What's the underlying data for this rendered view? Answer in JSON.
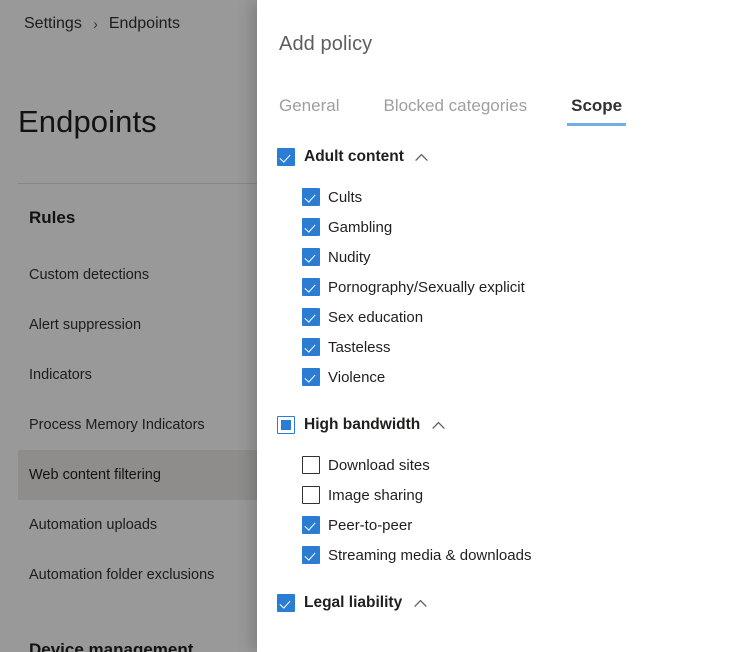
{
  "background": {
    "breadcrumb": {
      "items": [
        "Settings",
        "Endpoints"
      ],
      "separator": "›"
    },
    "page_title": "Endpoints",
    "nav_heading": "Rules",
    "nav_items": [
      {
        "label": "Custom detections",
        "selected": false
      },
      {
        "label": "Alert suppression",
        "selected": false
      },
      {
        "label": "Indicators",
        "selected": false
      },
      {
        "label": "Process Memory Indicators",
        "selected": false
      },
      {
        "label": "Web content filtering",
        "selected": true
      },
      {
        "label": "Automation uploads",
        "selected": false
      },
      {
        "label": "Automation folder exclusions",
        "selected": false
      }
    ],
    "nav_footer_heading": "Device management"
  },
  "panel": {
    "title": "Add policy",
    "tabs": [
      {
        "label": "General",
        "active": false
      },
      {
        "label": "Blocked categories",
        "active": false
      },
      {
        "label": "Scope",
        "active": true
      }
    ],
    "accent_color": "#71afe5",
    "checkbox_color": "#2b7cd3",
    "groups": [
      {
        "label": "Adult content",
        "state": "checked",
        "expanded": true,
        "chevron": "chevron-up-icon",
        "children": [
          {
            "label": "Cults",
            "state": "checked"
          },
          {
            "label": "Gambling",
            "state": "checked"
          },
          {
            "label": "Nudity",
            "state": "checked"
          },
          {
            "label": "Pornography/Sexually explicit",
            "state": "checked"
          },
          {
            "label": "Sex education",
            "state": "checked"
          },
          {
            "label": "Tasteless",
            "state": "checked"
          },
          {
            "label": "Violence",
            "state": "checked"
          }
        ]
      },
      {
        "label": "High bandwidth",
        "state": "indeterminate",
        "expanded": true,
        "chevron": "chevron-up-icon",
        "children": [
          {
            "label": "Download sites",
            "state": "unchecked"
          },
          {
            "label": "Image sharing",
            "state": "unchecked"
          },
          {
            "label": "Peer-to-peer",
            "state": "checked"
          },
          {
            "label": "Streaming media & downloads",
            "state": "checked"
          }
        ]
      },
      {
        "label": "Legal liability",
        "state": "checked",
        "expanded": true,
        "chevron": "chevron-up-icon",
        "children": []
      }
    ]
  }
}
